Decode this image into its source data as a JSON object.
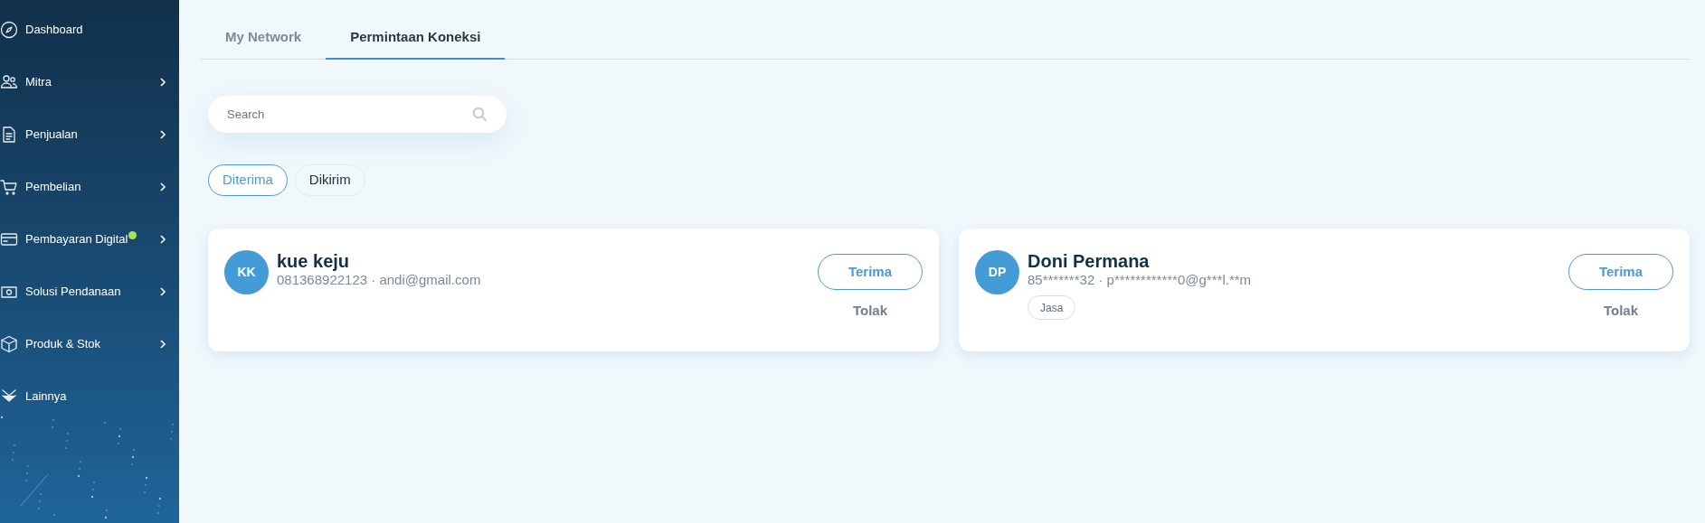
{
  "sidebar": {
    "items": [
      {
        "label": "Dashboard",
        "has_children": false,
        "notification": false
      },
      {
        "label": "Mitra",
        "has_children": true,
        "notification": false
      },
      {
        "label": "Penjualan",
        "has_children": true,
        "notification": false
      },
      {
        "label": "Pembelian",
        "has_children": true,
        "notification": false
      },
      {
        "label": "Pembayaran Digital",
        "has_children": true,
        "notification": true
      },
      {
        "label": "Solusi Pendanaan",
        "has_children": true,
        "notification": false
      },
      {
        "label": "Produk & Stok",
        "has_children": true,
        "notification": false
      },
      {
        "label": "Lainnya",
        "has_children": false,
        "notification": false
      }
    ]
  },
  "tabs": [
    {
      "label": "My Network",
      "selected": false
    },
    {
      "label": "Permintaan Koneksi",
      "selected": true
    }
  ],
  "search": {
    "placeholder": "Search"
  },
  "filters": [
    {
      "label": "Diterima",
      "selected": true
    },
    {
      "label": "Dikirim",
      "selected": false
    }
  ],
  "requests": [
    {
      "initials": "KK",
      "name": "kue keju",
      "contact": "081368922123 · andi@gmail.com",
      "accept": "Terima",
      "reject": "Tolak"
    },
    {
      "initials": "DP",
      "name": "Doni Permana",
      "contact": "85*******32 · p************0@g***l.**m",
      "tags": [
        "Jasa"
      ],
      "accept": "Terima",
      "reject": "Tolak"
    }
  ]
}
